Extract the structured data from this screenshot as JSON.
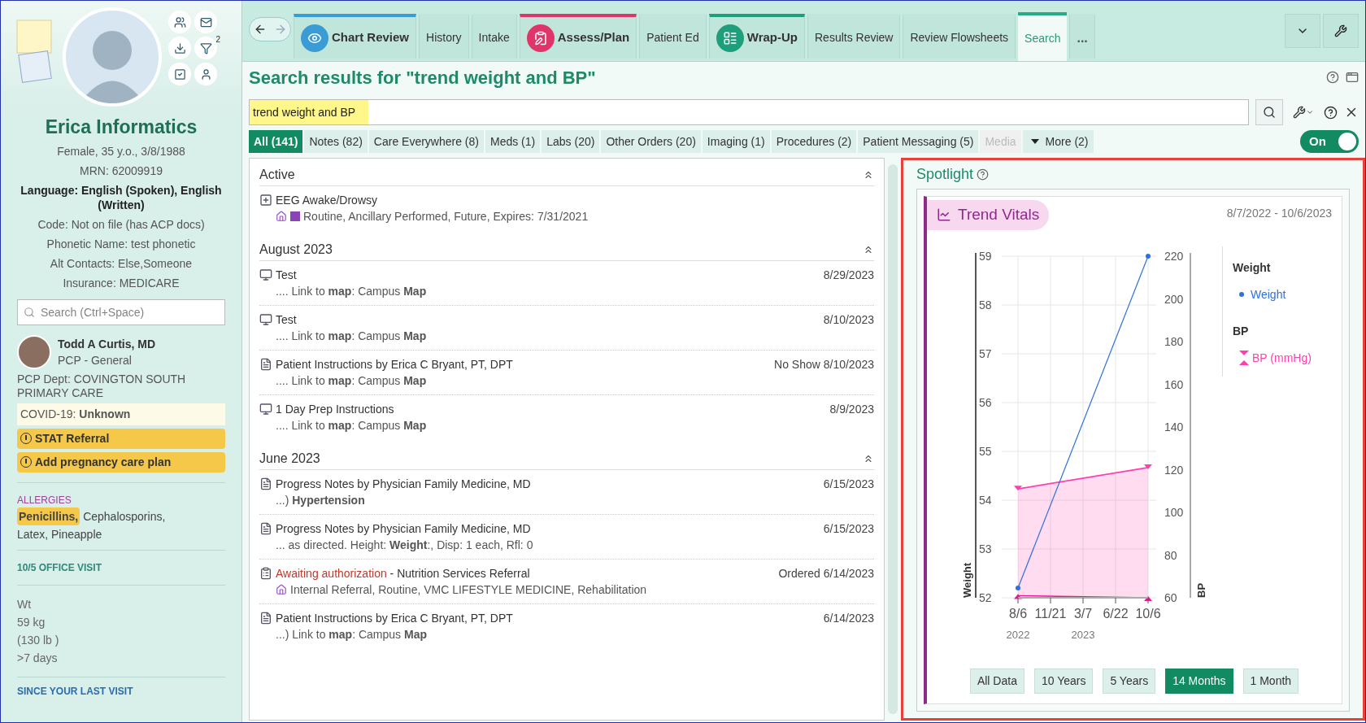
{
  "patient": {
    "name": "Erica Informatics",
    "details": [
      {
        "text": "Female, 35 y.o., 3/8/1988",
        "bold": false
      },
      {
        "text": "MRN: 62009919",
        "bold": false
      },
      {
        "text": "Language: English (Spoken), English (Written)",
        "bold": true
      },
      {
        "text": "Code: Not on file (has ACP docs)",
        "bold": false
      },
      {
        "text": "Phonetic Name: test phonetic",
        "bold": false
      },
      {
        "text": "Alt Contacts: Else,Someone",
        "bold": false
      },
      {
        "text": "Insurance: MEDICARE",
        "bold": false
      }
    ],
    "notification_count": "2",
    "search_placeholder": "Search (Ctrl+Space)",
    "pcp": {
      "name": "Todd A Curtis, MD",
      "role": "PCP - General",
      "dept": "PCP Dept: COVINGTON SOUTH PRIMARY CARE"
    },
    "covid": "COVID-19: **Unknown**",
    "alerts": [
      "STAT Referral",
      "Add pregnancy care plan"
    ],
    "allergies_heading": "ALLERGIES",
    "allergies": [
      {
        "text": "Penicillins,",
        "highlighted": true
      },
      {
        "text": "Cephalosporins,",
        "highlighted": false
      },
      {
        "text": "Latex, Pineapple",
        "highlighted": false
      }
    ],
    "visit_heading": "10/5 OFFICE VISIT",
    "vitals": [
      "Wt",
      "59 kg",
      "(130 lb )",
      ">7 days"
    ],
    "since_heading": "SINCE YOUR LAST VISIT"
  },
  "tabs": [
    {
      "label": "Chart Review",
      "kind": "icon",
      "color": "#3a9bd5",
      "selected": false
    },
    {
      "label": "History",
      "kind": "plain",
      "selected": false
    },
    {
      "label": "Intake",
      "kind": "plain",
      "selected": false
    },
    {
      "label": "Assess/Plan",
      "kind": "icon",
      "color": "#e0356b",
      "selected": false
    },
    {
      "label": "Patient Ed",
      "kind": "plain",
      "selected": false
    },
    {
      "label": "Wrap-Up",
      "kind": "icon",
      "color": "#1e9e7a",
      "selected": false
    },
    {
      "label": "Results Review",
      "kind": "plain",
      "selected": false
    },
    {
      "label": "Review Flowsheets",
      "kind": "plain",
      "selected": false
    },
    {
      "label": "Search",
      "kind": "plain",
      "selected": true
    },
    {
      "label": "...",
      "kind": "more",
      "selected": false
    }
  ],
  "page_title": "Search results for \"trend weight and BP\"",
  "search_value": "trend weight and BP",
  "filters": [
    {
      "label": "All (141)",
      "selected": true,
      "disabled": false,
      "kind": "tab"
    },
    {
      "label": "Notes (82)",
      "selected": false,
      "disabled": false,
      "kind": "tab"
    },
    {
      "label": "Care Everywhere (8)",
      "selected": false,
      "disabled": false,
      "kind": "tab"
    },
    {
      "label": "Meds (1)",
      "selected": false,
      "disabled": false,
      "kind": "tab"
    },
    {
      "label": "Labs (20)",
      "selected": false,
      "disabled": false,
      "kind": "tab"
    },
    {
      "label": "Other Orders (20)",
      "selected": false,
      "disabled": false,
      "kind": "tab"
    },
    {
      "label": "Imaging (1)",
      "selected": false,
      "disabled": false,
      "kind": "tab"
    },
    {
      "label": "Procedures (2)",
      "selected": false,
      "disabled": false,
      "kind": "tab"
    },
    {
      "label": "Patient Messaging (5)",
      "selected": false,
      "disabled": false,
      "kind": "tab"
    },
    {
      "label": "Media",
      "selected": false,
      "disabled": true,
      "kind": "tab"
    },
    {
      "label": "More (2)",
      "selected": false,
      "disabled": false,
      "kind": "dropdown"
    }
  ],
  "toggle": {
    "label": "On",
    "on": true
  },
  "results": [
    {
      "heading": "Active",
      "items": [
        {
          "kind": "order",
          "title": "EEG Awake/Drowsy",
          "subtitle": "Routine, Ancillary Performed, Future, Expires: 7/31/2021"
        }
      ]
    },
    {
      "heading": "August 2023",
      "items": [
        {
          "kind": "monitor",
          "title": "Test",
          "subtitle": ".... Link to **map**: Campus **Map**",
          "date": "8/29/2023"
        },
        {
          "kind": "monitor",
          "title": "Test",
          "subtitle": ".... Link to **map**: Campus **Map**",
          "date": "8/10/2023"
        },
        {
          "kind": "note",
          "title": "Patient Instructions by Erica C Bryant, PT, DPT",
          "subtitle": ".... Link to **map**: Campus **Map**",
          "date": "No Show 8/10/2023"
        },
        {
          "kind": "monitor",
          "title": "1 Day Prep Instructions",
          "subtitle": ".... Link to **map**: Campus **Map**",
          "date": "8/9/2023"
        }
      ]
    },
    {
      "heading": "June 2023",
      "items": [
        {
          "kind": "note",
          "title": "Progress Notes by Physician Family Medicine, MD",
          "subtitle": "...) **Hypertension**",
          "date": "6/15/2023"
        },
        {
          "kind": "note",
          "title": "Progress Notes by Physician Family Medicine, MD",
          "subtitle": "... as directed. Height: **Weight**:, Disp: 1 each, Rfl: 0",
          "date": "6/15/2023"
        },
        {
          "kind": "referral",
          "status": "Awaiting authorization",
          "title": " - Nutrition Services Referral",
          "subtitle": "Internal Referral, Routine, VMC LIFESTYLE MEDICINE, Rehabilitation",
          "date": "Ordered 6/14/2023"
        },
        {
          "kind": "note",
          "title": "Patient Instructions by Erica C Bryant, PT, DPT",
          "subtitle": "...) Link to **map**: Campus **Map**",
          "date": "6/14/2023"
        }
      ]
    }
  ],
  "spotlight": {
    "title": "Spotlight",
    "card_title": "Trend Vitals",
    "date_range": "8/7/2022 - 10/6/2023",
    "legend_headings": [
      "Weight",
      "BP"
    ],
    "weight": {
      "chart_data": {
        "type": "line",
        "ylabel": "Weight",
        "categories": [
          "8/6",
          "11/21",
          "3/7",
          "6/22",
          "10/6"
        ],
        "series": [
          {
            "name": "Weight",
            "color": "#2f6fe0",
            "marker": "circle",
            "values": [
              52.2,
              null,
              null,
              null,
              59
            ]
          }
        ],
        "ylim": [
          52,
          59
        ],
        "yticks": [
          52,
          53,
          54,
          55,
          56,
          57,
          58,
          59
        ]
      }
    },
    "year_labels": [
      "2022",
      "2023"
    ],
    "bp": {
      "chart_data": {
        "type": "area",
        "ylabel": "BP",
        "grid": true,
        "categories": [
          null,
          null,
          null,
          null,
          null
        ],
        "series": [
          {
            "name": "BP (mmHg)",
            "color": "#ff3fae",
            "marker": "triangle",
            "values": [
              111,
              null,
              null,
              null,
              121
            ]
          },
          {
            "color": "#e8159a",
            "type": "line",
            "marker": "triangle",
            "values": [
              61,
              null,
              null,
              null,
              60
            ]
          }
        ],
        "ylim": [
          60,
          220
        ],
        "yticks": [
          60,
          80,
          100,
          120,
          140,
          160,
          180,
          200,
          220
        ]
      }
    },
    "ranges": [
      {
        "label": "All Data",
        "selected": false
      },
      {
        "label": "10 Years",
        "selected": false
      },
      {
        "label": "5 Years",
        "selected": false
      },
      {
        "label": "14 Months",
        "selected": true
      },
      {
        "label": "1 Month",
        "selected": false
      }
    ]
  }
}
